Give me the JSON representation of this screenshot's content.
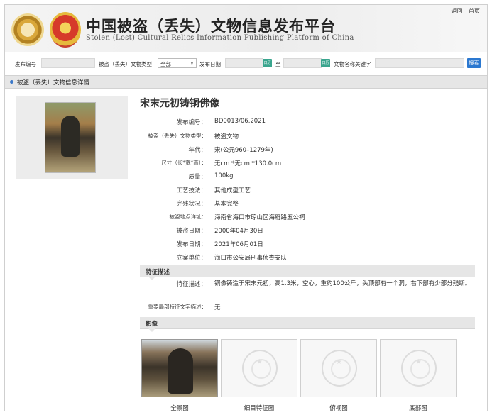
{
  "header": {
    "title_cn": "中国被盗（丢失）文物信息发布平台",
    "title_en": "Stolen (Lost) Cultural Relics Information Publishing Platform of China",
    "links": [
      "返回",
      "首页"
    ]
  },
  "search": {
    "label_id": "发布编号",
    "label_type": "被盗（丢失）文物类型",
    "type_value": "全部",
    "label_date": "发布日期",
    "label_to": "至",
    "label_keyword": "文物名称关键字",
    "button": "搜索",
    "cal_glyph": "日历"
  },
  "section": {
    "title": "被盗（丢失）文物信息详情"
  },
  "detail": {
    "title": "宋末元初铸铜佛像",
    "fields": [
      {
        "key": "发布编号：",
        "value": "BD0013/06.2021"
      },
      {
        "key": "被盗（丢失）文物类型：",
        "value": "被盗文物"
      },
      {
        "key": "年代：",
        "value": "宋(公元960–1279年)"
      },
      {
        "key": "尺寸（长*宽*高）：",
        "value": "无cm *无cm *130.0cm"
      },
      {
        "key": "质量：",
        "value": "100kg"
      },
      {
        "key": "工艺技法：",
        "value": "其他成型工艺"
      },
      {
        "key": "完残状况：",
        "value": "基本完整"
      },
      {
        "key": "被盗地点详址：",
        "value": "海南省海口市琼山区海府路五公祠"
      },
      {
        "key": "被盗日期：",
        "value": "2000年04月30日"
      },
      {
        "key": "发布日期：",
        "value": "2021年06月01日"
      },
      {
        "key": "立案单位：",
        "value": "海口市公安局刑事侦查支队"
      }
    ]
  },
  "features": {
    "title": "特征描述",
    "desc_key": "特征描述：",
    "desc_value": "铜像铸造于宋末元初，高1.3米，空心，重约100公斤，头顶部有一个洞，右下部有少部分残断。",
    "local_key": "重要局部特征文字描述：",
    "local_value": "无"
  },
  "images": {
    "title": "影像",
    "captions": [
      "全景图",
      "细目特征图",
      "俯视图",
      "底部图"
    ]
  },
  "colors": {
    "accent_blue": "#2b78d0",
    "calendar_green": "#3aa58e",
    "bar_gray": "#e6e6e6"
  }
}
